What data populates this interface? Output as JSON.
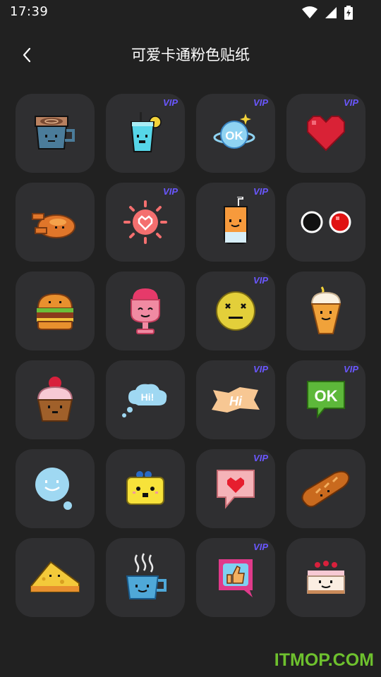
{
  "status_bar": {
    "time": "17:39"
  },
  "header": {
    "title": "可爱卡通粉色贴纸",
    "back_icon": "chevron-left-icon"
  },
  "stickers": [
    {
      "name": "coffee-cup",
      "badge": ""
    },
    {
      "name": "lemon-drink",
      "badge": "VIP"
    },
    {
      "name": "ok-planet",
      "badge": "VIP"
    },
    {
      "name": "red-heart",
      "badge": "VIP"
    },
    {
      "name": "roast-chicken",
      "badge": ""
    },
    {
      "name": "pink-sun-heart",
      "badge": "VIP"
    },
    {
      "name": "orange-juice",
      "badge": "VIP"
    },
    {
      "name": "black-red-dots",
      "badge": ""
    },
    {
      "name": "burger",
      "badge": ""
    },
    {
      "name": "pink-ice-cream",
      "badge": ""
    },
    {
      "name": "yellow-smiley",
      "badge": "VIP"
    },
    {
      "name": "ice-cream-cone",
      "badge": ""
    },
    {
      "name": "cupcake",
      "badge": ""
    },
    {
      "name": "hi-cloud-bubble",
      "badge": ""
    },
    {
      "name": "hi-tag",
      "badge": "VIP"
    },
    {
      "name": "ok-speech-bubble",
      "badge": "VIP"
    },
    {
      "name": "blue-smiley-bubble",
      "badge": ""
    },
    {
      "name": "toast-face",
      "badge": ""
    },
    {
      "name": "heart-speech-bubble",
      "badge": "VIP"
    },
    {
      "name": "bread-loaf",
      "badge": ""
    },
    {
      "name": "cheese-slice",
      "badge": ""
    },
    {
      "name": "hot-tea-cup",
      "badge": ""
    },
    {
      "name": "thumbs-up-bubble",
      "badge": "VIP"
    },
    {
      "name": "cherry-cake",
      "badge": ""
    }
  ],
  "sticker_texts": {
    "ok_planet": "OK",
    "hi_cloud": "Hi!",
    "hi_tag": "Hi",
    "ok_bubble": "OK"
  },
  "watermark": "ITMOP.COM",
  "colors": {
    "background": "#212121",
    "tile": "#2f2f31",
    "vip": "#6a57ff",
    "watermark": "#6ec12e"
  }
}
